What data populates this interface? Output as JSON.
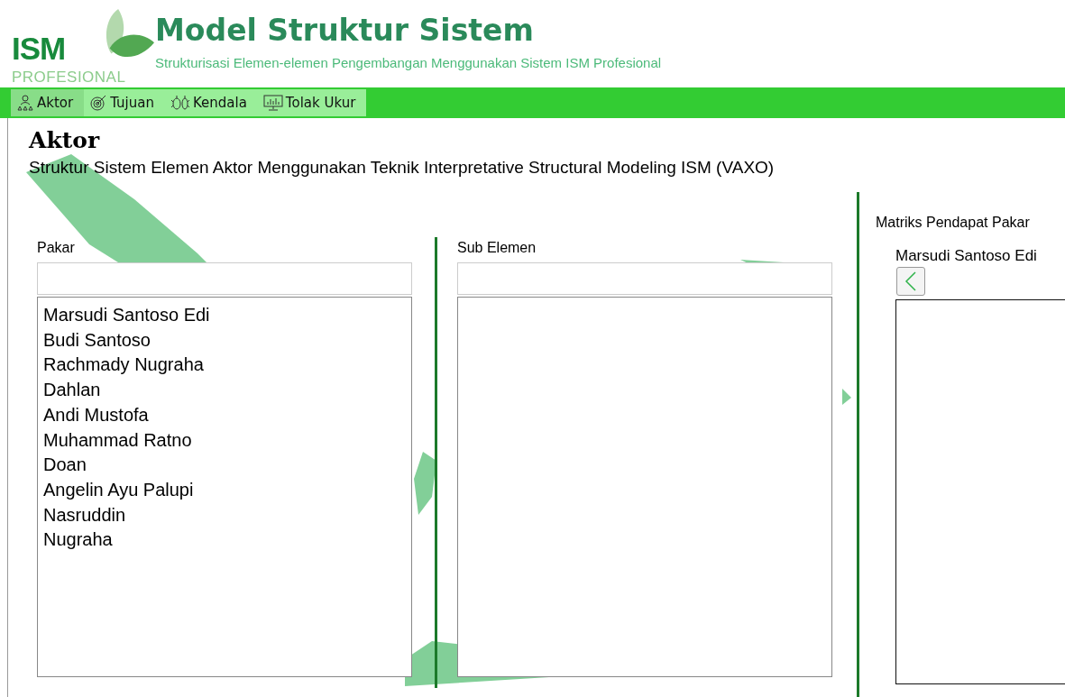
{
  "header": {
    "logo_text": "ISM",
    "logo_subtext": "PROFESIONAL",
    "title": "Model Struktur Sistem",
    "subtitle": "Strukturisasi Elemen-elemen Pengembangan Menggunakan Sistem ISM Profesional"
  },
  "tabs": [
    {
      "label": "Aktor",
      "selected": true
    },
    {
      "label": "Tujuan",
      "selected": false
    },
    {
      "label": "Kendala",
      "selected": false
    },
    {
      "label": "Tolak Ukur",
      "selected": false
    }
  ],
  "page": {
    "title": "Aktor",
    "subtitle": "Struktur Sistem Elemen Aktor  Menggunakan Teknik Interpretative Structural Modeling ISM (VAXO)"
  },
  "pakar": {
    "label": "Pakar",
    "items": [
      "Marsudi Santoso Edi",
      "Budi Santoso",
      "Rachmady Nugraha",
      "Dahlan",
      "Andi Mustofa",
      "Muhammad Ratno",
      "Doan",
      "Angelin Ayu Palupi",
      "Nasruddin",
      "Nugraha"
    ]
  },
  "sub_elemen": {
    "label": "Sub Elemen"
  },
  "matriks": {
    "label": "Matriks Pendapat Pakar",
    "expert": "Marsudi Santoso Edi"
  }
}
